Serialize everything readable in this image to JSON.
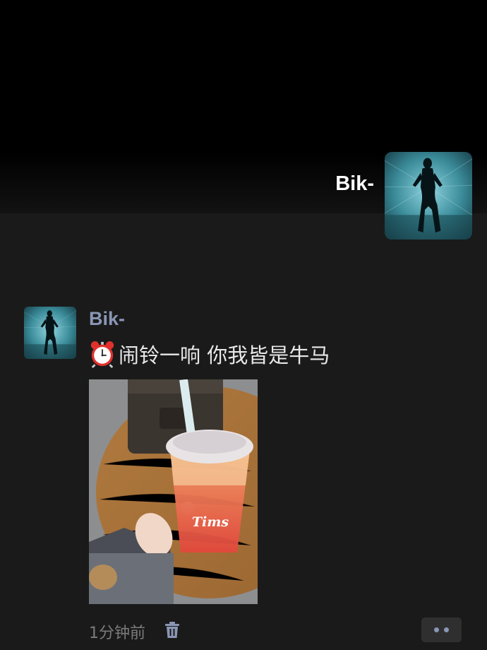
{
  "header": {
    "username": "Bik-"
  },
  "post": {
    "author": "Bik-",
    "text": "闹铃一响  你我皆是牛马",
    "emoji_icon": "alarm-clock-icon",
    "photo_brand_text": "Tims",
    "timestamp": "1分钟前"
  },
  "actions": {
    "delete_icon": "trash-icon",
    "more_icon": "more-dots-icon"
  },
  "colors": {
    "author_name": "#8a96b5",
    "background": "#1a1a1a",
    "header_bg": "#000000"
  }
}
